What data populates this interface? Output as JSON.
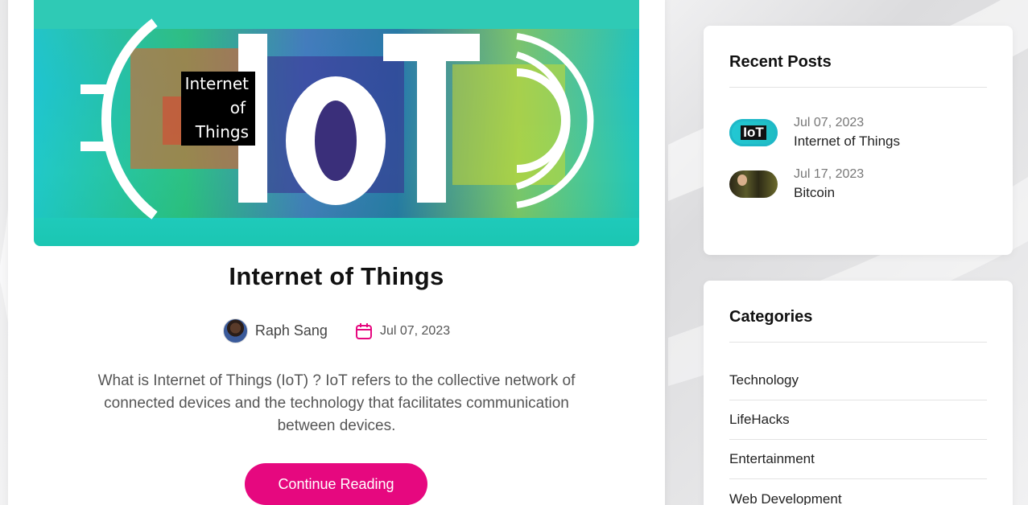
{
  "post": {
    "hero_alt": "IoT",
    "hero_badge": [
      "Internet",
      "of",
      "Things"
    ],
    "title": "Internet of Things",
    "author": "Raph Sang",
    "date": "Jul 07, 2023",
    "excerpt": "What is Internet of Things (IoT) ? IoT refers to the collective network of connected devices and the technology that facilitates communication between devices.",
    "cta": "Continue Reading"
  },
  "recent_posts": {
    "title": "Recent Posts",
    "items": [
      {
        "date": "Jul 07, 2023",
        "title": "Internet of Things",
        "thumb_text": "IoT"
      },
      {
        "date": "Jul 17, 2023",
        "title": "Bitcoin"
      }
    ]
  },
  "categories": {
    "title": "Categories",
    "items": [
      "Technology",
      "LifeHacks",
      "Entertainment",
      "Web Development"
    ]
  },
  "colors": {
    "accent": "#e6087f",
    "hero_teal": "#21c6d8"
  }
}
